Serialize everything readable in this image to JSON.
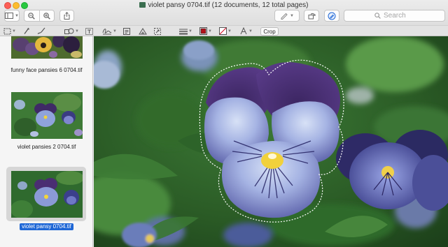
{
  "window": {
    "title": "violet pansy 0704.tif (12 documents, 12 total pages)",
    "traffic_lights": [
      "close",
      "minimize",
      "zoom"
    ]
  },
  "toolbar": {
    "sidebar_toggle_icon": "sidebar-icon",
    "zoom_out_icon": "zoom-out-icon",
    "zoom_in_icon": "zoom-in-icon",
    "share_icon": "share-icon",
    "highlight_icon": "pen-highlight-icon",
    "rotate_icon": "rotate-icon",
    "markup_icon": "markup-icon",
    "search": {
      "placeholder": "Search",
      "value": ""
    }
  },
  "markup": {
    "tools": [
      "rect-selection-icon",
      "instant-alpha-icon",
      "sketch-icon",
      "shapes-icon",
      "text-icon",
      "sign-icon",
      "note-icon",
      "adjust-color-icon",
      "adjust-size-icon",
      "line-style-icon",
      "border-color-icon",
      "fill-color-icon",
      "text-style-icon"
    ],
    "border_color": "#b3121a",
    "crop_label": "Crop"
  },
  "sidebar": {
    "items": [
      {
        "label": "funny face pansies 6 0704.tif",
        "selected": false
      },
      {
        "label": "violet pansies 2 0704.tif",
        "selected": false
      },
      {
        "label": "violet pansy 0704.tif",
        "selected": true
      }
    ]
  },
  "canvas": {
    "selection": "dashed outline around pansy"
  }
}
